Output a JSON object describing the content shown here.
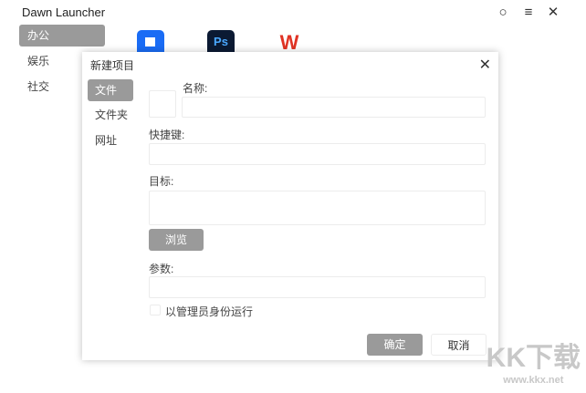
{
  "app": {
    "title": "Dawn Launcher",
    "icons": [
      "search-icon",
      "menu-icon",
      "close-icon"
    ]
  },
  "sidebar": {
    "items": [
      {
        "label": "办公",
        "active": true
      },
      {
        "label": "娱乐"
      },
      {
        "label": "社交"
      }
    ]
  },
  "apps": [
    {
      "name": "flowus",
      "color": "#1a6cf5"
    },
    {
      "name": "photoshop",
      "color": "#0b1a33",
      "text": "Ps"
    },
    {
      "name": "wps",
      "color": "#e03324"
    }
  ],
  "dialog": {
    "title": "新建项目",
    "tabs": [
      {
        "label": "文件",
        "active": true
      },
      {
        "label": "文件夹"
      },
      {
        "label": "网址"
      }
    ],
    "name_label": "名称:",
    "name_value": "",
    "hotkey_label": "快捷键:",
    "hotkey_value": "",
    "target_label": "目标:",
    "target_value": "",
    "browse": "浏览",
    "params_label": "参数:",
    "params_value": "",
    "admin_label": "以管理员身份运行",
    "admin_checked": false,
    "ok": "确定",
    "cancel": "取消"
  },
  "watermark": {
    "logo": "KK下载",
    "url": "www.kkx.net"
  }
}
